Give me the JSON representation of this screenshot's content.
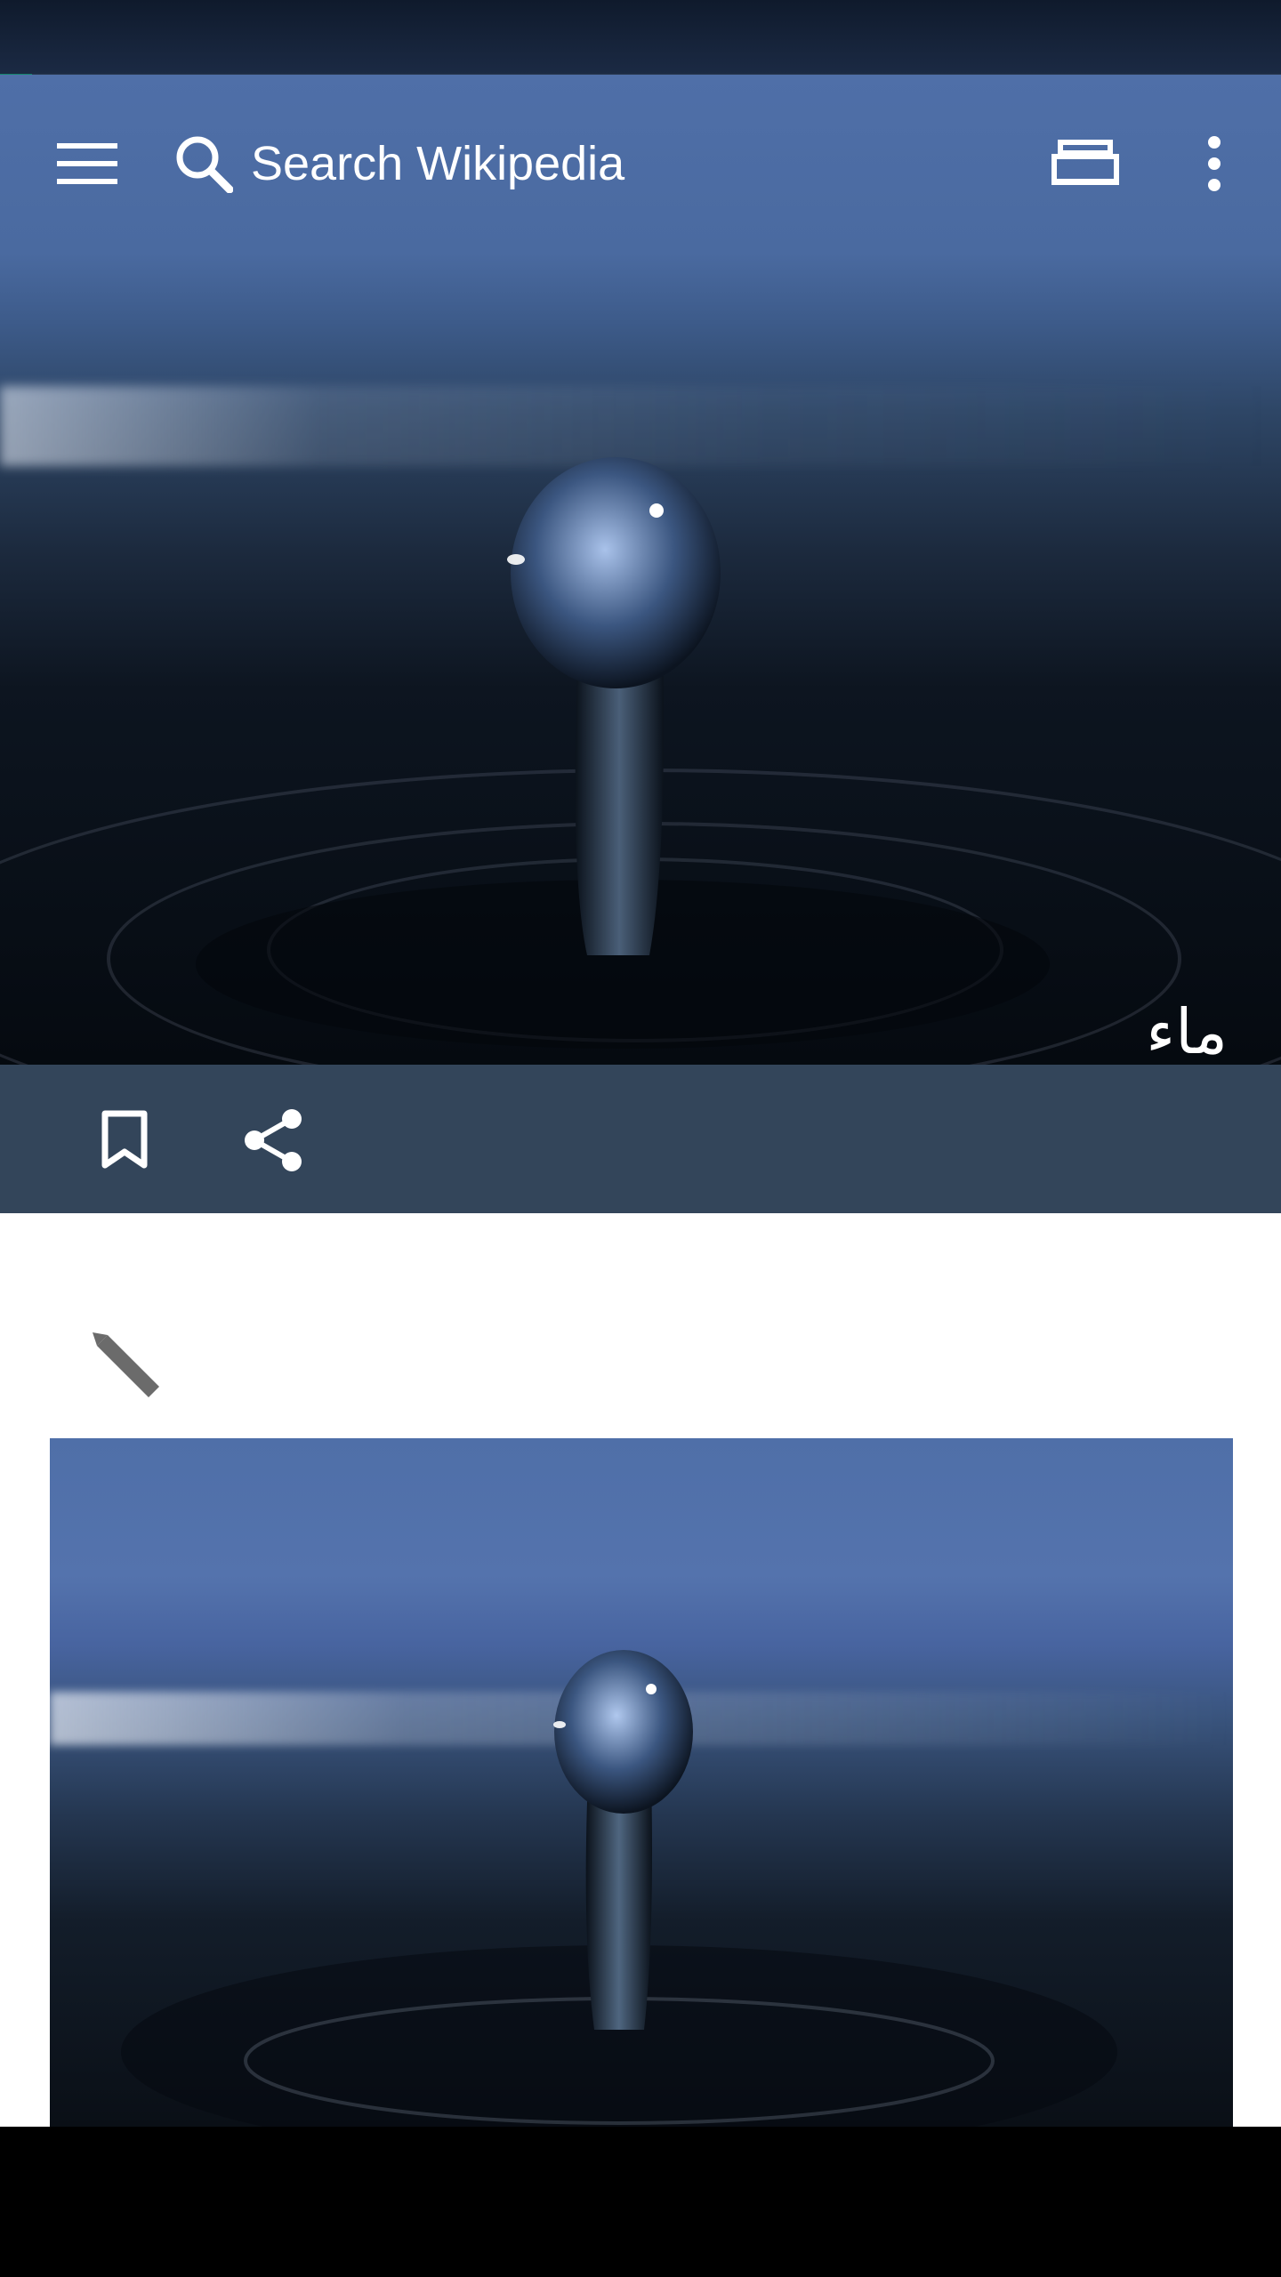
{
  "progress": {
    "value_percent": 2.5,
    "color": "#14866d"
  },
  "toolbar": {
    "menu_icon": "hamburger-menu-icon",
    "search_icon": "search-icon",
    "search_placeholder": "Search Wikipedia",
    "tabs_icon": "tabs-icon",
    "overflow_icon": "overflow-menu-icon"
  },
  "article": {
    "title": "ماء",
    "lead_image": "water-drop-photo"
  },
  "actions": {
    "bookmark_icon": "bookmark-icon",
    "share_icon": "share-icon"
  },
  "content": {
    "edit_icon": "pencil-icon",
    "figure": "water-drop-photo"
  },
  "colors": {
    "action_bar": "#33455a",
    "content_bg": "#ffffff",
    "edit_icon": "#6b6b6b"
  }
}
